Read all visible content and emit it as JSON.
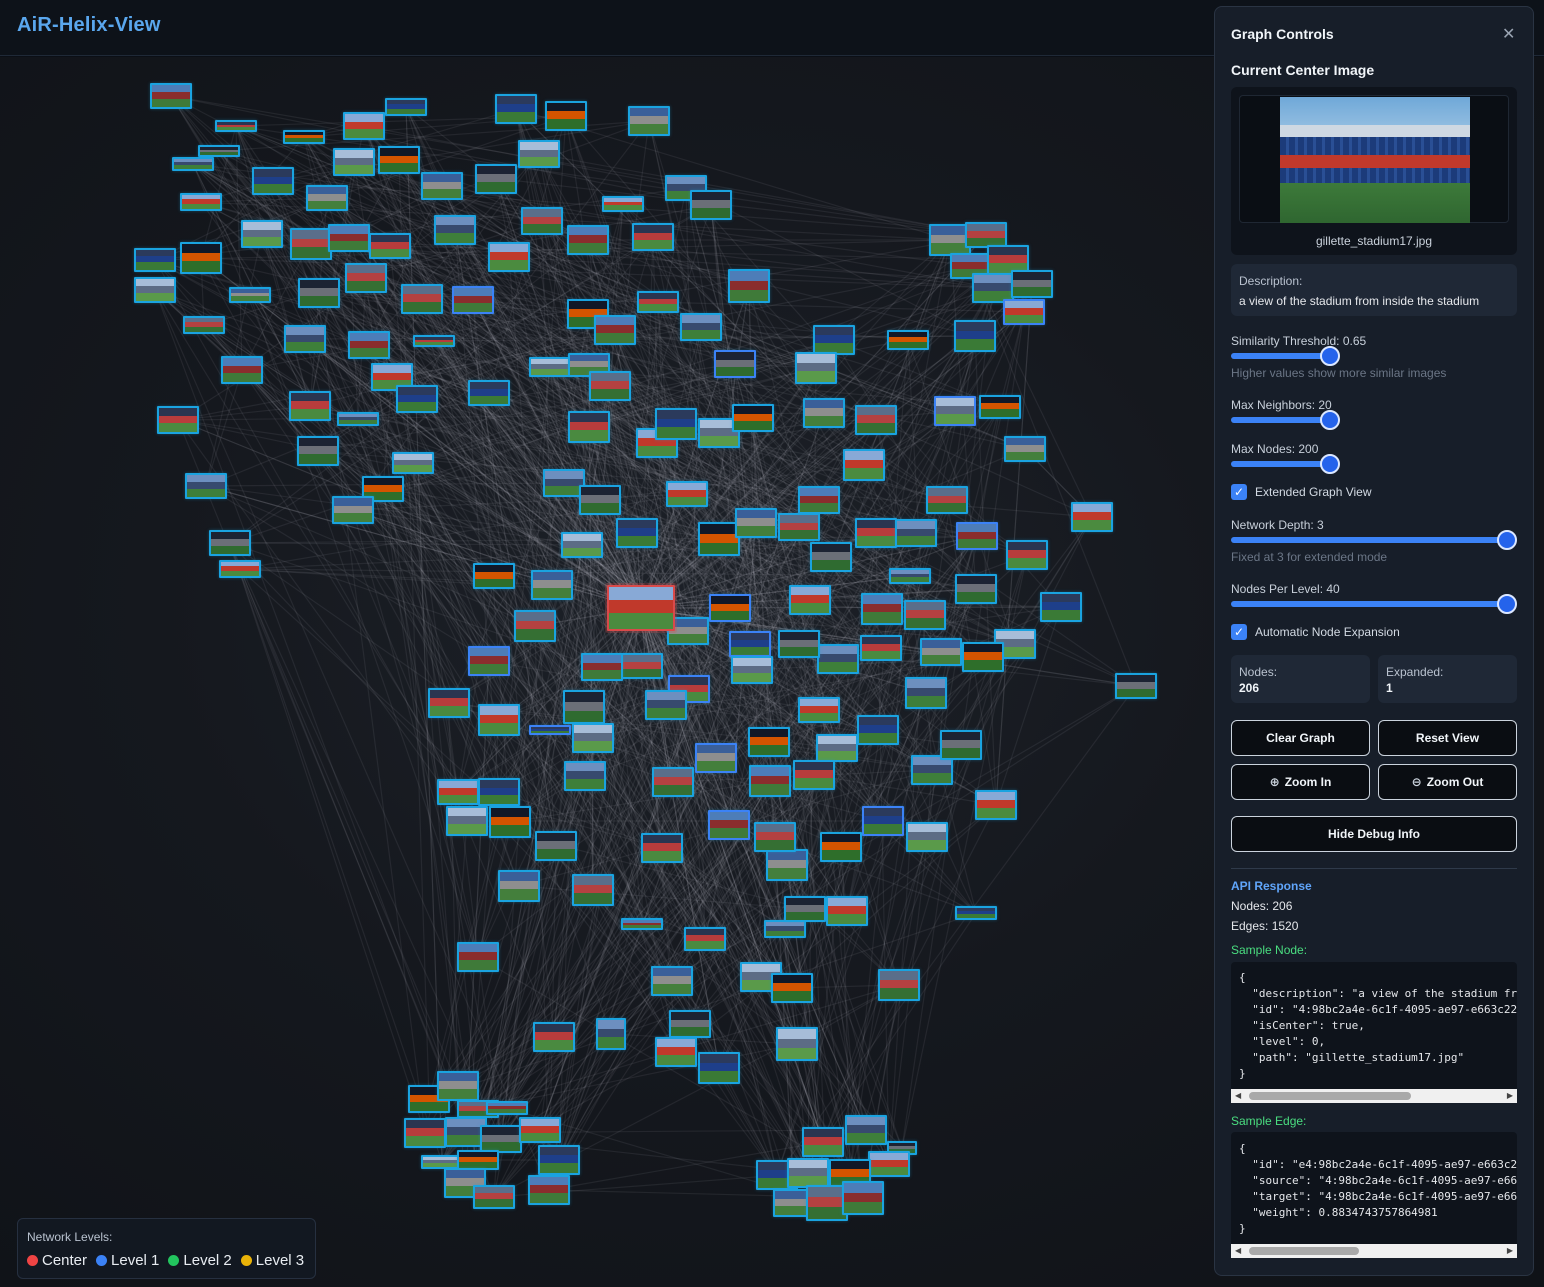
{
  "app": {
    "title": "AiR-Helix-View"
  },
  "legend": {
    "title": "Network Levels:",
    "items": [
      {
        "label": "Center",
        "color": "#ef4444"
      },
      {
        "label": "Level 1",
        "color": "#3b82f6"
      },
      {
        "label": "Level 2",
        "color": "#22c55e"
      },
      {
        "label": "Level 3",
        "color": "#eab308"
      }
    ]
  },
  "colors": {
    "node_border": "#1aa3e0",
    "level1_border": "#3b82f6",
    "center_border": "#d94a4a",
    "accent": "#3b82f6"
  },
  "panel": {
    "title": "Graph Controls",
    "close_icon": "close-icon",
    "current_center_title": "Current Center Image",
    "image_caption": "gillette_stadium17.jpg",
    "description_label": "Description:",
    "description_text": "a view of the stadium from inside the stadium",
    "similarity_label": "Similarity Threshold: 0.65",
    "similarity_value": 0.65,
    "similarity_hint": "Higher values show more similar images",
    "max_neighbors_label": "Max Neighbors: 20",
    "max_neighbors_fraction": 0.35,
    "max_nodes_label": "Max Nodes: 200",
    "max_nodes_fraction": 0.35,
    "extended_view_label": "Extended Graph View",
    "extended_view_checked": true,
    "network_depth_label": "Network Depth: 3",
    "network_depth_fraction": 1.0,
    "network_depth_hint": "Fixed at 3 for extended mode",
    "nodes_per_level_label": "Nodes Per Level: 40",
    "nodes_per_level_fraction": 1.0,
    "auto_expand_label": "Automatic Node Expansion",
    "auto_expand_checked": true,
    "stats": [
      {
        "label": "Nodes:",
        "value": "206"
      },
      {
        "label": "Expanded:",
        "value": "1"
      }
    ],
    "buttons": {
      "clear": "Clear Graph",
      "reset": "Reset View",
      "zoom_in": "Zoom In",
      "zoom_out": "Zoom Out",
      "debug": "Hide Debug Info"
    },
    "api": {
      "title": "API Response",
      "nodes_line": "Nodes: 206",
      "edges_line": "Edges: 1520",
      "sample_node_title": "Sample Node:",
      "sample_node_lines": [
        "{",
        "  \"description\": \"a view of the stadium fr",
        "  \"id\": \"4:98bc2a4e-6c1f-4095-ae97-e663c22",
        "  \"isCenter\": true,",
        "  \"level\": 0,",
        "  \"path\": \"gillette_stadium17.jpg\"",
        "}"
      ],
      "sample_edge_title": "Sample Edge:",
      "sample_edge_lines": [
        "{",
        "  \"id\": \"e4:98bc2a4e-6c1f-4095-ae97-e663c2",
        "  \"source\": \"4:98bc2a4e-6c1f-4095-ae97-e66",
        "  \"target\": \"4:98bc2a4e-6c1f-4095-ae97-e66",
        "  \"weight\": 0.8834743757864981",
        "}"
      ]
    }
  }
}
